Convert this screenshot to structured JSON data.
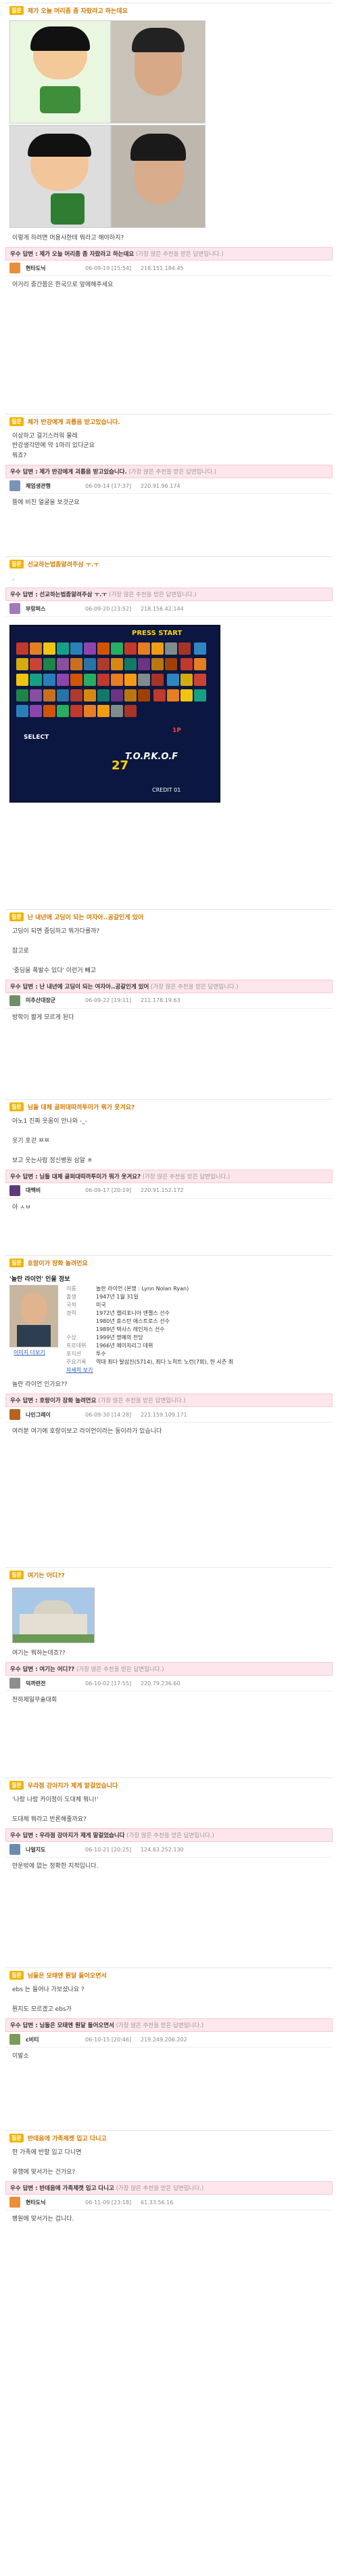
{
  "badge": "질문",
  "answer_prefix": "우수 답변 :",
  "answer_tip": "(가장 많은 추천을 받은 답변입니다.)",
  "posts": [
    {
      "title": "제가 오늘 머리좀 좀 자랐라고 하는데요",
      "body": "이렇게 하려면 머용사한테 뭐라고 해야하지?",
      "answer_title": "제가 오늘 머리좀 좀 자랐라고 하는데요",
      "user": "현타도닉",
      "date": "06-09-19 [15:54]",
      "ip": "218.151.184.45",
      "answer": "어거리 중간쯤은 한국으로 앞에해주세요"
    },
    {
      "title": "제가 반강에게 괴롭음 받고있습니다.",
      "body": "이상하고 걸기스러워 물레\n반강생각만에 약 1마리 있다군요\n뭐죠?",
      "answer_title": "제가 반강에게 괴롭음 받고있습니다.",
      "user": "체엄생관행",
      "date": "06-09-14 [17:37]",
      "ip": "220.91.96.174",
      "answer": "뜰에 비친 얼굴을 보것군요"
    },
    {
      "title": "선교하는법좀알려주삼 ㅜ.ㅜ",
      "body": ".",
      "answer_title": "선교하는법좀알려주삼 ㅜ.ㅜ",
      "user": "부랑퍼스",
      "date": "06-09-20 [23:52]",
      "ip": "218.156.42.144",
      "answer": "",
      "game_text": {
        "top": "PRESS START",
        "mid": "1P",
        "bottom": "CREDIT 01",
        "vs": "SELECT",
        "timer": "27",
        "logo": "T.O.P.K.O.F"
      }
    },
    {
      "title": "난 내년에 고딩이 되는 여자아..공갈인게 있어",
      "body": "고딩이 되면 중딩하고 뭐가다를까?\n\n참고로\n\n'중딩을 폭발수 있다' 이런거 빼고",
      "answer_title": "난 내년에 고딩이 되는 여자아..공갈인게 있어",
      "user": "미추산대장군",
      "date": "06-09-22 [19:11]",
      "ip": "211.178.19.63",
      "answer": "방학이 짧게 모르게 된다"
    },
    {
      "title": "님들 대체 골퍼대따까투미가 뭐가 웃겨요?",
      "body": "아노1 진짜 웃움이 안나와 -_-\n\n웃기 포걷 ㅉㅉ\n\n보고 웃는사람 정신병원 삼알 ㅎ",
      "answer_title": "님들 대체 골퍼대따까투미가 뭐가 웃겨요?",
      "user": "대백비",
      "date": "06-09-17 [20:19]",
      "ip": "220.91.152.172",
      "answer": "아 ㅅㅂ"
    },
    {
      "title": "호랑이가 장화 놀려먼요",
      "body": "놀란 라이언 인가요??",
      "answer_title": "호랑이가 장화 놀려먼요",
      "user": "나인그레이",
      "date": "06-09-30 [14:28]",
      "ip": "221.159.109.171",
      "answer": "여러분 여기에 호랑이보고 라이언이라는 동이라가 있습니다",
      "card": {
        "heading": "'놀란 라이언' 인물 정보",
        "photo_caption": "이미지 더보기",
        "more": "자세히 보기",
        "rows": [
          [
            "이름",
            "놀란 라이언 (본명 : Lynn Nolan Ryan)"
          ],
          [
            "출생",
            "1947년 1월 31일"
          ],
          [
            "국적",
            "미국"
          ],
          [
            "경력",
            "1972년 캘리포니아 엔젤스 선수"
          ],
          [
            "",
            "1980년 휴스턴 애스트로스 선수"
          ],
          [
            "",
            "1989년 텍사스 레인저스 선수"
          ],
          [
            "수상",
            "1999년 명예의 전당"
          ],
          [
            "프로데뷔",
            "1966년 메이저리그 데뷔"
          ],
          [
            "포지션",
            "투수"
          ],
          [
            "주요기록",
            "역대 최다 탈삼진(5714), 최다 노히트 노런(7회), 한 시즌 최"
          ]
        ]
      }
    },
    {
      "title": "여기는 어디??",
      "body": "여기는 뭐하는데죠??",
      "answer_title": "여기는 어디??",
      "user": "덕까련전",
      "date": "06-10-02 [17:55]",
      "ip": "220.79.236.60",
      "answer": "천하제일무술대회"
    },
    {
      "title": "우라점 강아지가 제게 말걸었습니다",
      "body": "'나랑 나랑 카이정이 도대체 뭐니!'\n\n도대체 뭐라고 반론해줄까요?",
      "answer_title": "우라점 강아지가 제게 말걸었습니다",
      "user": "나얼지도",
      "date": "06-10-21 [20:25]",
      "ip": "124.63.252.130",
      "answer": "만운밖에 없는 정확한 지적입니다."
    },
    {
      "title": "님들은 모태엔 뭔달 들어오면서",
      "body": "ebs 는 들어나 가보셨나요 ?\n\n뭔지도 모르겠고 ebs가",
      "answer_title": "님들은 모태엔 뭔달 들어오면서",
      "user": "c비티",
      "date": "06-10-15 [20:46]",
      "ip": "219.249.206.202",
      "answer": "이발소"
    },
    {
      "title": "반데음에 가족제켓 입고 다니고",
      "body": "한 가족에 반할 입고 다니면\n\n유행에 맞서가는 건가요?",
      "answer_title": "반데음에 가족제켓 입고 다니고",
      "user": "현타도닉",
      "date": "06-11-09 [23:18]",
      "ip": "61.33.56.16",
      "answer": "병원에 맞서가는 겁니다."
    }
  ]
}
